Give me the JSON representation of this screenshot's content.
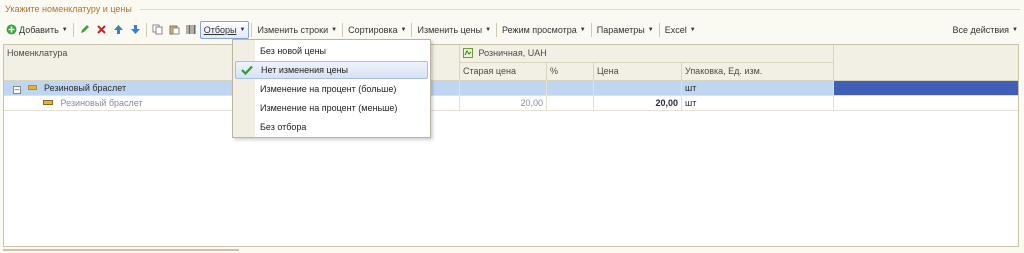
{
  "group": {
    "title": "Укажите номенклатуру и цены"
  },
  "toolbar": {
    "add_label": "Добавить",
    "filters_label": "Отборы",
    "change_rows_label": "Изменить строки",
    "sort_label": "Сортировка",
    "change_prices_label": "Изменить цены",
    "view_mode_label": "Режим просмотра",
    "params_label": "Параметры",
    "excel_label": "Excel",
    "all_actions_label": "Все действия"
  },
  "grid": {
    "col_nomenclature": "Номенклатура",
    "price_type": "Розничная, UAH",
    "col_old_price": "Старая цена",
    "col_percent": "%",
    "col_price": "Цена",
    "col_pack": "Упаковка, Ед. изм.",
    "rows": [
      {
        "name": "Резиновый браслет",
        "old_price": "",
        "percent": "",
        "price": "",
        "pack": "шт"
      },
      {
        "name": "Резиновый браслет",
        "old_price": "20,00",
        "percent": "",
        "price": "20,00",
        "pack": "шт"
      }
    ]
  },
  "menu": {
    "items": [
      {
        "label": "Без новой цены",
        "checked": false
      },
      {
        "label": "Нет изменения цены",
        "checked": true
      },
      {
        "label": "Изменение на процент (больше)",
        "checked": false
      },
      {
        "label": "Изменение на процент (меньше)",
        "checked": false
      },
      {
        "label": "Без отбора",
        "checked": false
      }
    ]
  },
  "colors": {
    "accent": "#b0732c",
    "selection": "#bfd6f1",
    "selection_end": "#3f5fb8",
    "check": "#2e9a2e"
  }
}
